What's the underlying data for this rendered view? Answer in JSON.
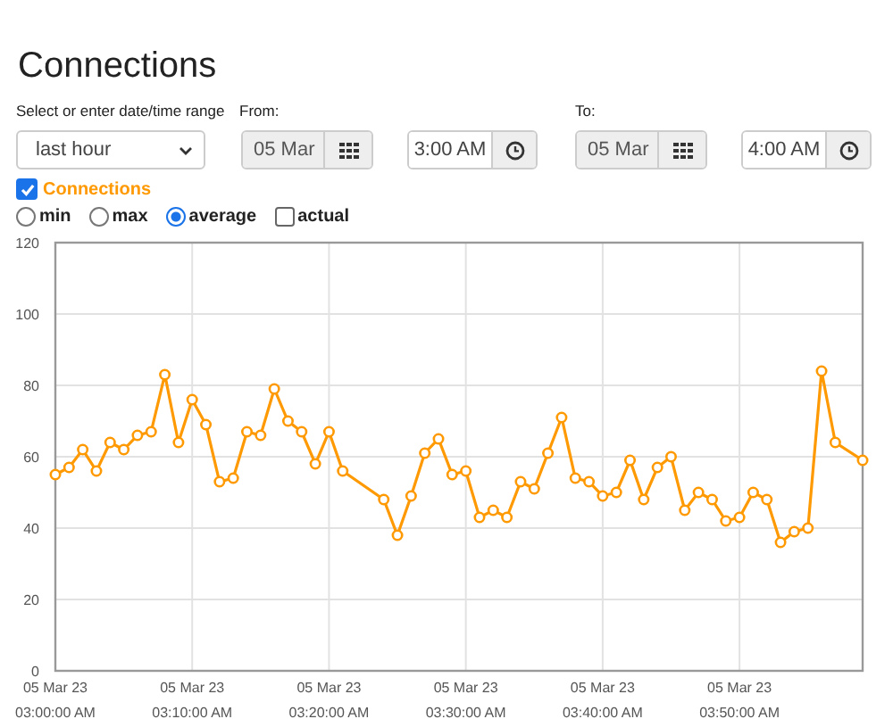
{
  "title": "Connections",
  "range": {
    "label": "Select or enter date/time range",
    "value": "last hour"
  },
  "from": {
    "label": "From:",
    "date": "05 Mar",
    "time": "3:00 AM"
  },
  "to": {
    "label": "To:",
    "date": "05 Mar",
    "time": "4:00 AM"
  },
  "series_toggle": {
    "checked": true
  },
  "options": [
    {
      "label": "min",
      "kind": "radio",
      "selected": false
    },
    {
      "label": "max",
      "kind": "radio",
      "selected": false
    },
    {
      "label": "average",
      "kind": "radio",
      "selected": true
    },
    {
      "label": "actual",
      "kind": "checkbox",
      "selected": false
    }
  ],
  "chart_data": {
    "type": "line",
    "categories": [
      "05 Mar 23\n03:00:00 AM",
      null,
      null,
      null,
      null,
      null,
      null,
      null,
      null,
      null,
      "05 Mar 23\n03:10:00 AM",
      null,
      null,
      null,
      null,
      null,
      null,
      null,
      null,
      null,
      "05 Mar 23\n03:20:00 AM",
      null,
      null,
      null,
      null,
      null,
      null,
      null,
      null,
      null,
      "05 Mar 23\n03:30:00 AM",
      null,
      null,
      null,
      null,
      null,
      null,
      null,
      null,
      null,
      "05 Mar 23\n03:40:00 AM",
      null,
      null,
      null,
      null,
      null,
      null,
      null,
      null,
      null,
      "05 Mar 23\n03:50:00 AM",
      null,
      null,
      null,
      null,
      null,
      null,
      null,
      null,
      null
    ],
    "series": [
      {
        "name": "Connections",
        "color": "#ff9900",
        "marker": "circle",
        "values": [
          55,
          57,
          62,
          56,
          64,
          62,
          66,
          67,
          83,
          64,
          76,
          69,
          53,
          54,
          67,
          66,
          79,
          70,
          67,
          58,
          67,
          56,
          null,
          null,
          48,
          38,
          49,
          61,
          65,
          55,
          56,
          43,
          45,
          43,
          53,
          51,
          61,
          71,
          54,
          53,
          49,
          50,
          59,
          48,
          57,
          60,
          45,
          50,
          48,
          42,
          43,
          50,
          48,
          36,
          39,
          40,
          84,
          64,
          null,
          59
        ]
      }
    ],
    "grid": true,
    "ylim": [
      0,
      120
    ],
    "yticks": [
      0,
      20,
      40,
      60,
      80,
      100,
      120
    ]
  }
}
